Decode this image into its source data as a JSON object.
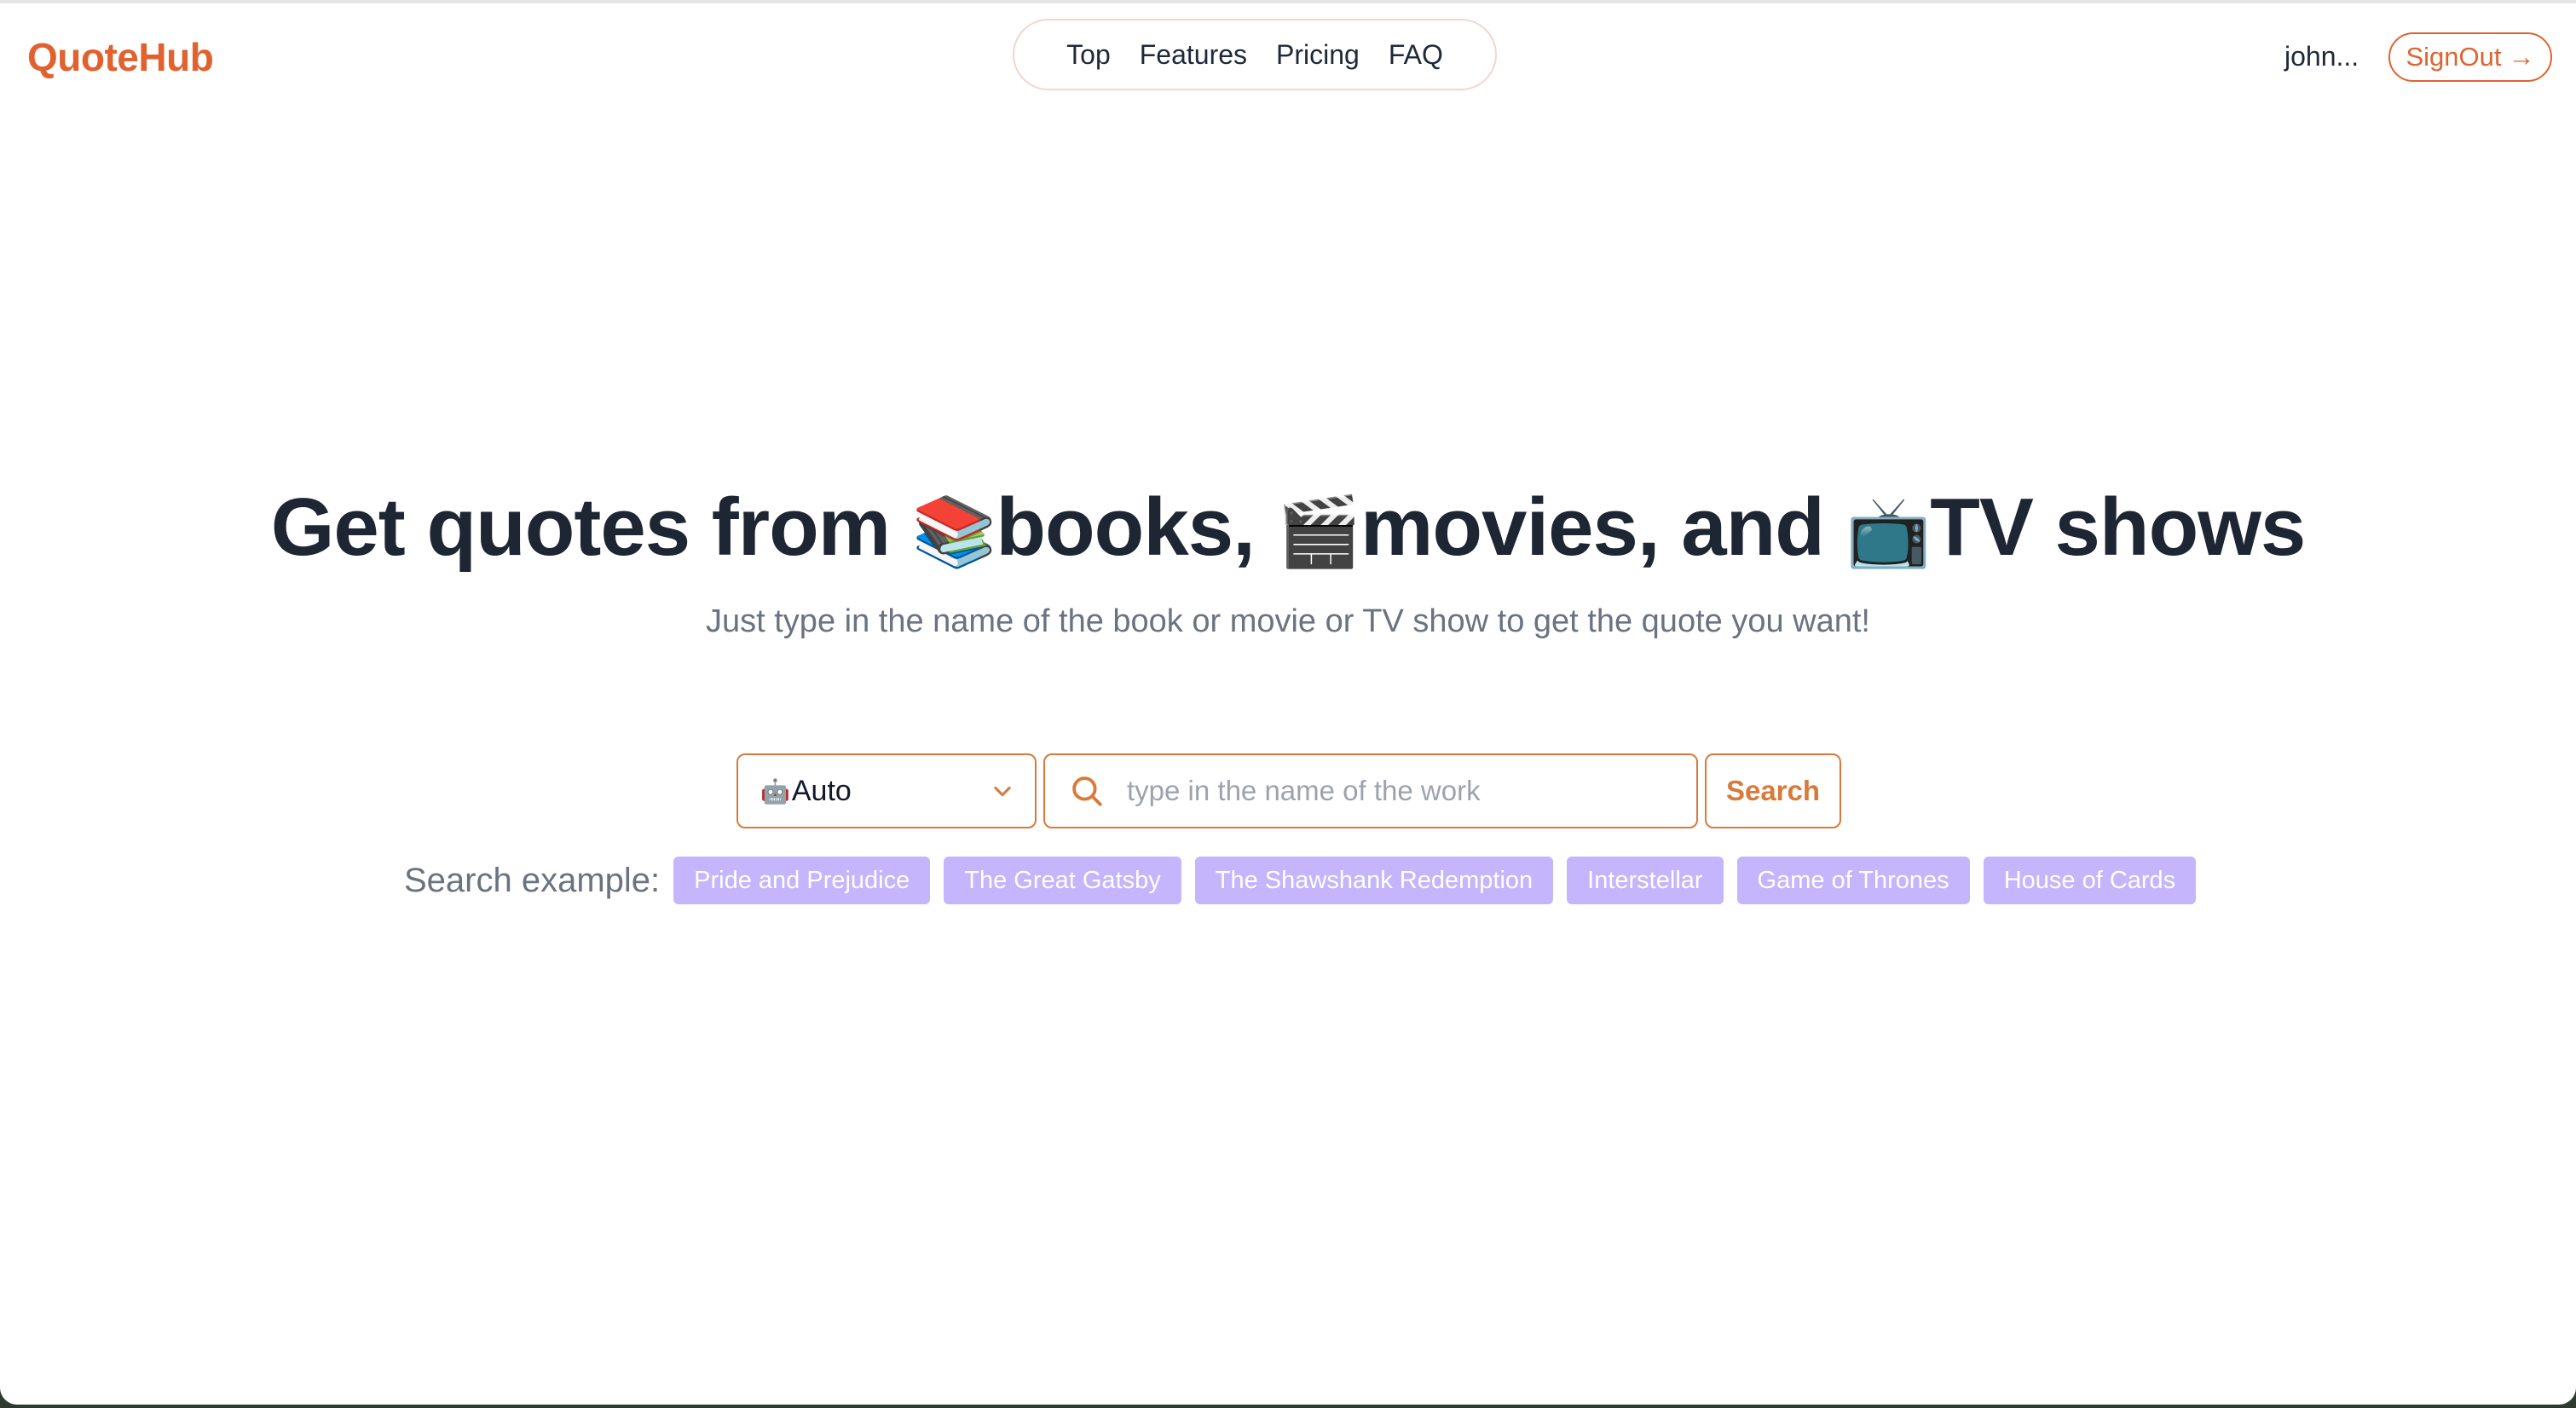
{
  "brand": {
    "name": "QuoteHub"
  },
  "nav": {
    "links": [
      "Top",
      "Features",
      "Pricing",
      "FAQ"
    ]
  },
  "user": {
    "name": "john...",
    "signout_label": "SignOut",
    "signout_arrow": "→"
  },
  "hero": {
    "title_prefix": "Get quotes from ",
    "books_emoji": "📚",
    "books_label": "books, ",
    "movies_emoji": "🎬",
    "movies_label": "movies, and ",
    "tv_emoji": "📺",
    "tv_label": "TV shows",
    "subtitle": "Just type in the name of the book or movie or TV show to get the quote you want!"
  },
  "search": {
    "mode_icon": "🤖",
    "mode_value": "Auto",
    "placeholder": "type in the name of the work",
    "value": "",
    "button_label": "Search"
  },
  "examples": {
    "label": "Search example:",
    "items": [
      "Pride and Prejudice",
      "The Great Gatsby",
      "The Shawshank Redemption",
      "Interstellar",
      "Game of Thrones",
      "House of Cards"
    ]
  },
  "colors": {
    "brand": "#e0632f",
    "accent": "#d97a3a",
    "chip": "#c4b5fd",
    "title": "#1e2533",
    "muted": "#6b7280"
  }
}
